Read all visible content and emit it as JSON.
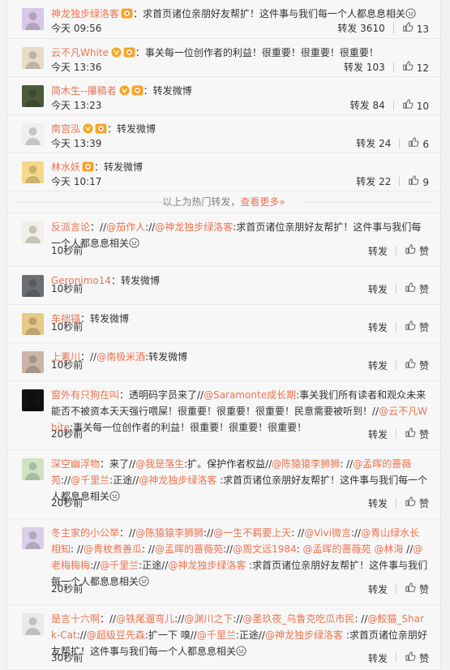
{
  "hot_reposts": [
    {
      "name": "神龙独步绿洛客",
      "text": "：求首页诸位亲朋好友帮扩！这件事与我们每一个人都息息相关",
      "time": "今天 09:56",
      "repost_label": "转发",
      "repost_count": "3610",
      "like_count": "13"
    },
    {
      "name": "云不凡White",
      "text": "：事关每一位创作者的利益！很重要！很重要！很重要！",
      "time": "今天 13:36",
      "repost_label": "转发",
      "repost_count": "103",
      "like_count": "12"
    },
    {
      "name": "简木生--攥稿者",
      "text": "：转发微博",
      "time": "今天 13:23",
      "repost_label": "转发",
      "repost_count": "84",
      "like_count": "10"
    },
    {
      "name": "南宫泓",
      "text": "：转发微博",
      "time": "今天 13:39",
      "repost_label": "转发",
      "repost_count": "24",
      "like_count": "6"
    },
    {
      "name": "林水妖",
      "text": "：转发微博",
      "time": "今天 10:17",
      "repost_label": "转发",
      "repost_count": "22",
      "like_count": "9"
    }
  ],
  "hot_divider": {
    "text": "以上为热门转发，",
    "link": "查看更多»"
  },
  "reposts": [
    {
      "name": "反派言论",
      "segments": [
        {
          "t": "："
        },
        {
          "t": "//",
          "m": false
        },
        {
          "t": "@茄作人",
          "m": true
        },
        {
          "t": ":"
        },
        {
          "t": "//",
          "m": false
        },
        {
          "t": "@神龙独步绿洛客",
          "m": true
        },
        {
          "t": ":求首页诸位亲朋好友帮扩！这件事与我们每一个人都息息相关"
        }
      ],
      "time": "10秒前",
      "repost_label": "转发",
      "like_label": "赞"
    },
    {
      "name": "Geronimo14",
      "segments": [
        {
          "t": "：转发微博"
        }
      ],
      "time": "10秒前",
      "repost_label": "转发",
      "like_label": "赞"
    },
    {
      "name": "车拙锚",
      "segments": [
        {
          "t": "：转发微博"
        }
      ],
      "time": "10秒前",
      "repost_label": "转发",
      "like_label": "赞"
    },
    {
      "name": "上素川",
      "segments": [
        {
          "t": "：//"
        },
        {
          "t": "@南极米酒",
          "m": true
        },
        {
          "t": ":转发微博"
        }
      ],
      "time": "10秒前",
      "repost_label": "转发",
      "like_label": "赞"
    },
    {
      "name": "窗外有只狗在叫",
      "segments": [
        {
          "t": "：透明码字员来了//"
        },
        {
          "t": "@Saramonte成长期",
          "m": true
        },
        {
          "t": ":事关我们所有读者和观众未来能否不被资本天天强行喂屎！很重要！很重要！很重要！民意需要被听到！"
        },
        {
          "t": "//"
        },
        {
          "t": "@云不凡White",
          "m": true
        },
        {
          "t": ":事关每一位创作者的利益！很重要！很重要！很重要！"
        }
      ],
      "time": "20秒前",
      "repost_label": "转发",
      "like_label": "赞"
    },
    {
      "name": "深空幽浮物",
      "segments": [
        {
          "t": "：来了//"
        },
        {
          "t": "@我是落生",
          "m": true
        },
        {
          "t": ":扩。保护作者权益//"
        },
        {
          "t": "@陈猿猿李狮狮",
          "m": true
        },
        {
          "t": ": //"
        },
        {
          "t": "@孟晖的蔷薇苑",
          "m": true
        },
        {
          "t": "://"
        },
        {
          "t": "@千里兰",
          "m": true
        },
        {
          "t": ":正途//"
        },
        {
          "t": "@神龙独步绿洛客",
          "m": true
        },
        {
          "t": " :求首页诸位亲朋好友帮扩！这件事与我们每一个人都息息相关"
        }
      ],
      "time": "20秒前",
      "repost_label": "转发",
      "like_label": "赞"
    },
    {
      "name": "冬主家的小公举",
      "segments": [
        {
          "t": "：//"
        },
        {
          "t": "@陈猿猿李狮狮",
          "m": true
        },
        {
          "t": "://"
        },
        {
          "t": "@一生不羁要上天",
          "m": true
        },
        {
          "t": ": //"
        },
        {
          "t": "@Vivi微言",
          "m": true
        },
        {
          "t": "://"
        },
        {
          "t": "@青山绿水长相知",
          "m": true
        },
        {
          "t": ": //"
        },
        {
          "t": "@青枚煮善瓜",
          "m": true
        },
        {
          "t": ": //"
        },
        {
          "t": "@孟晖的蔷薇苑",
          "m": true
        },
        {
          "t": "://"
        },
        {
          "t": "@周文远1984",
          "m": true
        },
        {
          "t": ": "
        },
        {
          "t": "@孟晖的蔷薇苑",
          "m": true
        },
        {
          "t": " "
        },
        {
          "t": "@林海",
          "m": true
        },
        {
          "t": " //"
        },
        {
          "t": "@老梅梅梅",
          "m": true
        },
        {
          "t": "://"
        },
        {
          "t": "@千里兰",
          "m": true
        },
        {
          "t": ":正途//"
        },
        {
          "t": "@神龙独步绿洛客",
          "m": true
        },
        {
          "t": " :求首页诸位亲朋好友帮扩！这件事与我们每一个人都息息相关"
        }
      ],
      "time": "20秒前",
      "repost_label": "转发",
      "like_label": "赞"
    },
    {
      "name": "是言十六啊",
      "segments": [
        {
          "t": "：//"
        },
        {
          "t": "@铁尾遛弯儿",
          "m": true
        },
        {
          "t": "://"
        },
        {
          "t": "@渊川之下",
          "m": true
        },
        {
          "t": "://"
        },
        {
          "t": "@墨玖夜_乌鲁克吃瓜市民",
          "m": true
        },
        {
          "t": ": //"
        },
        {
          "t": "@鲛猫_Shark-Cat",
          "m": true
        },
        {
          "t": "://"
        },
        {
          "t": "@超级豆先森",
          "m": true
        },
        {
          "t": ":扩一下 嗅//"
        },
        {
          "t": "@千里兰",
          "m": true
        },
        {
          "t": ":正途//"
        },
        {
          "t": "@神龙独步绿洛客",
          "m": true
        },
        {
          "t": " :求首页诸位亲朋好友帮扩！这件事与我们每一个人都息息相关"
        }
      ],
      "time": "30秒前",
      "repost_label": "转发",
      "like_label": "赞"
    }
  ],
  "colors": {
    "accent": "#eb7350",
    "text": "#333333",
    "muted": "#808080",
    "v_badge": "#f5a623"
  },
  "icons": {
    "like": "thumbs-up-icon",
    "verified": "verified-v-icon",
    "vip": "vip-level-icon",
    "emoji": "face-emoji-icon"
  }
}
